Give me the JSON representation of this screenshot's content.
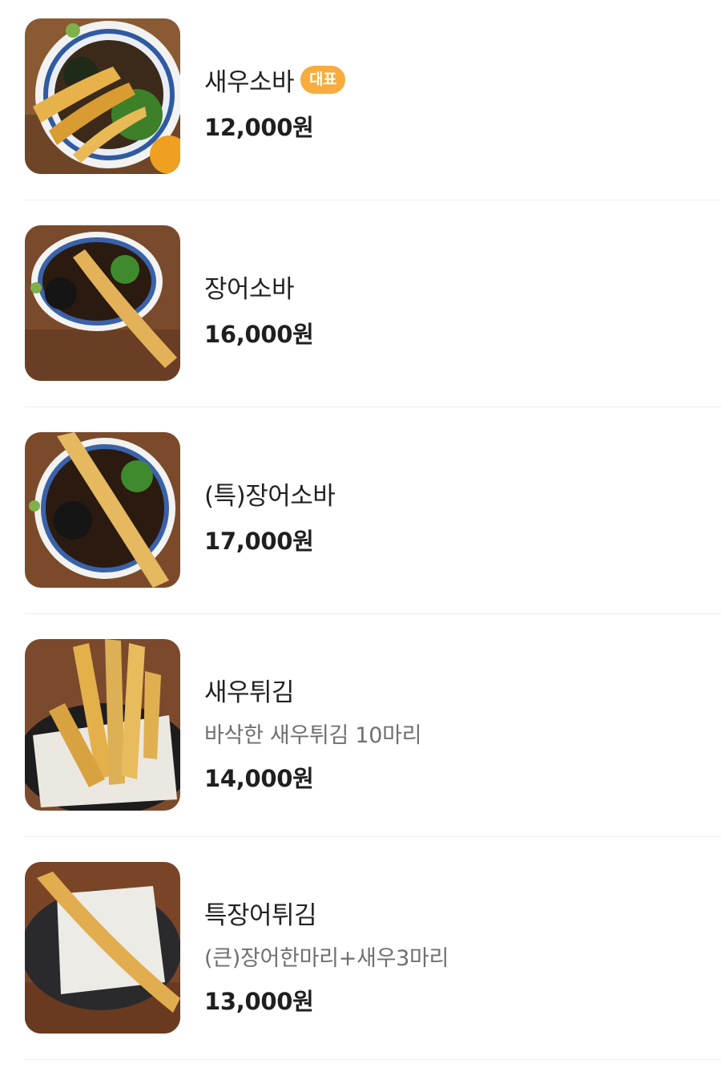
{
  "menu": {
    "items": [
      {
        "name": "새우소바",
        "badge": "대표",
        "description": "",
        "price": "12,000원",
        "image": "shrimp-tempura-soba-photo"
      },
      {
        "name": "장어소바",
        "badge": "",
        "description": "",
        "price": "16,000원",
        "image": "eel-tempura-soba-photo"
      },
      {
        "name": "(특)장어소바",
        "badge": "",
        "description": "",
        "price": "17,000원",
        "image": "special-eel-soba-photo"
      },
      {
        "name": "새우튀김",
        "badge": "",
        "description": "바삭한 새우튀김 10마리",
        "price": "14,000원",
        "image": "shrimp-tempura-photo"
      },
      {
        "name": "특장어튀김",
        "badge": "",
        "description": "(큰)장어한마리+새우3마리",
        "price": "13,000원",
        "image": "special-eel-tempura-photo"
      }
    ]
  },
  "colors": {
    "badge": "#f7ac3d",
    "divider": "#ececec",
    "price": "#1f1f1f",
    "description": "#6f6f6f"
  }
}
